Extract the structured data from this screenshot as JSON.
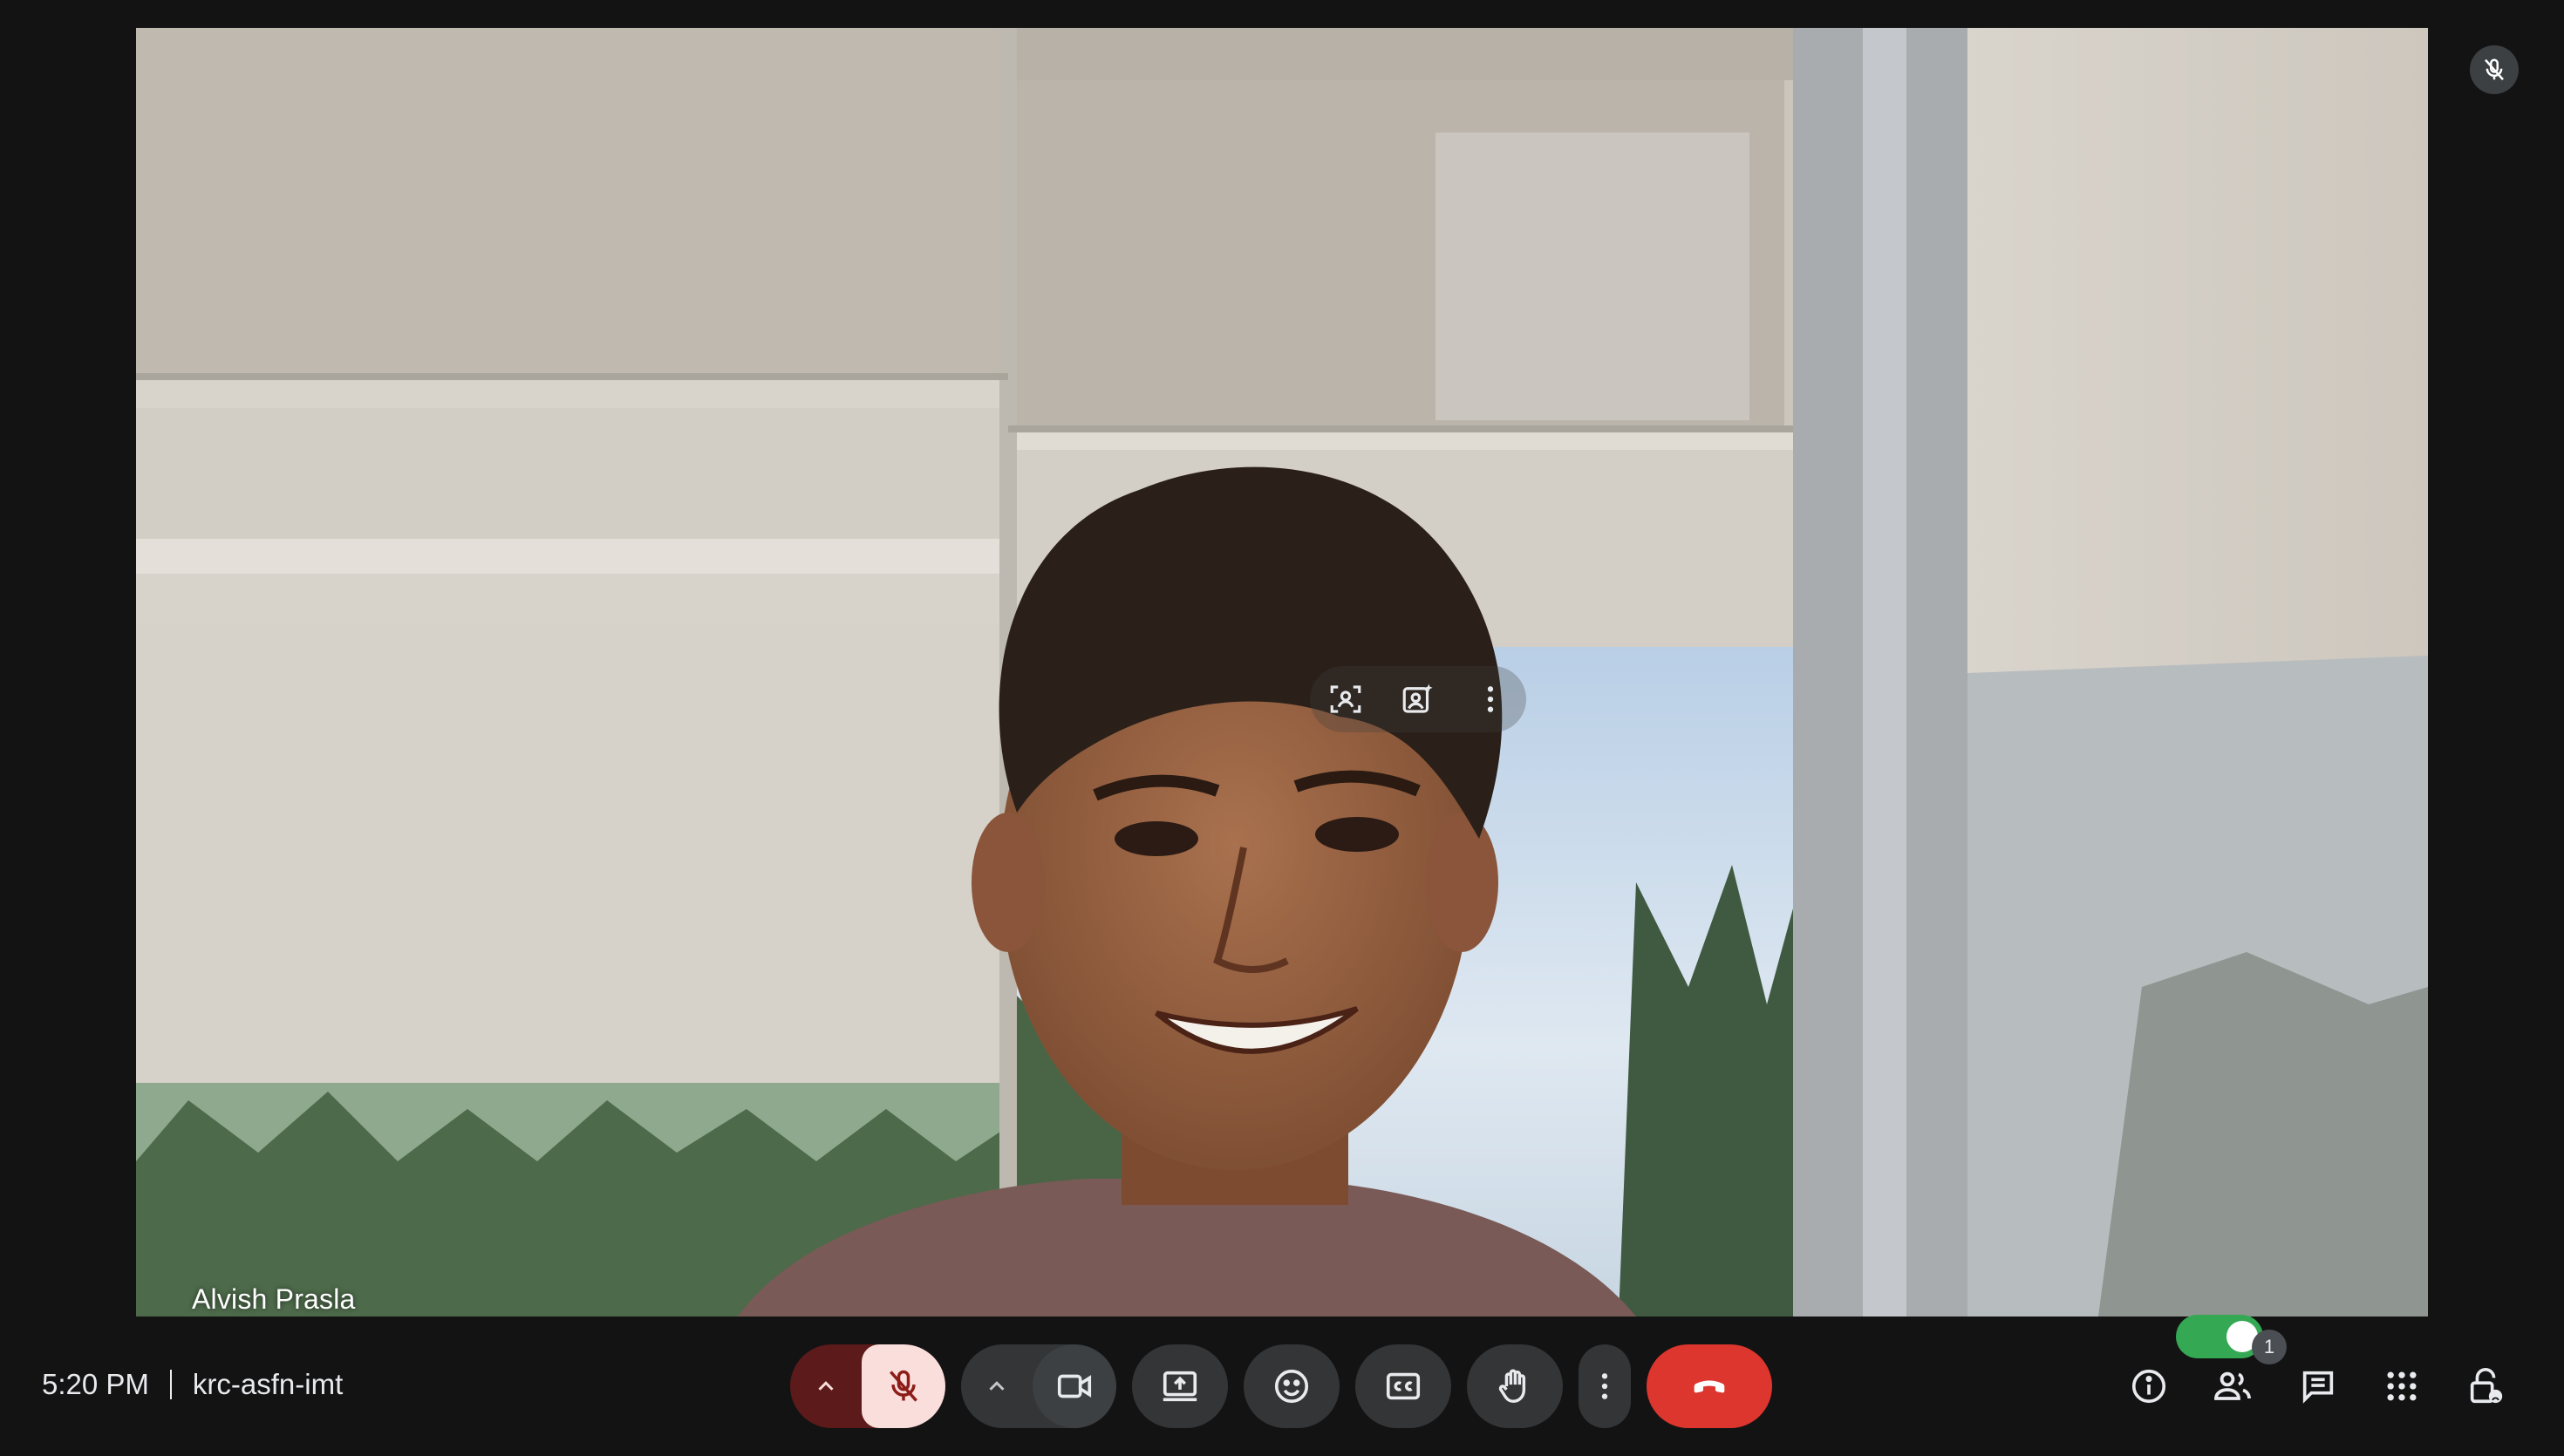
{
  "meeting": {
    "time": "5:20 PM",
    "code": "krc-asfn-imt"
  },
  "participant": {
    "name": "Alvish Prasla",
    "muted": true
  },
  "participants_count": "1",
  "colors": {
    "background": "#131313",
    "button_bg": "#333537",
    "mic_group_bg": "#5c1a1a",
    "mic_active_bg": "#f9dedc",
    "end_call": "#dc362e",
    "toggle_on": "#34a853"
  },
  "video_controls": {
    "icons": [
      "frame-person-icon",
      "visual-effects-icon",
      "more-vert-icon"
    ]
  },
  "controls": {
    "icons": [
      "chevron-up-icon",
      "mic-off-icon",
      "chevron-up-icon",
      "videocam-icon",
      "present-screen-icon",
      "emoji-icon",
      "captions-icon",
      "raise-hand-icon",
      "more-vert-icon",
      "end-call-icon"
    ]
  },
  "right_panel": {
    "icons": [
      "info-icon",
      "people-icon",
      "chat-icon",
      "apps-icon",
      "host-controls-icon"
    ],
    "toggle_on": true
  }
}
